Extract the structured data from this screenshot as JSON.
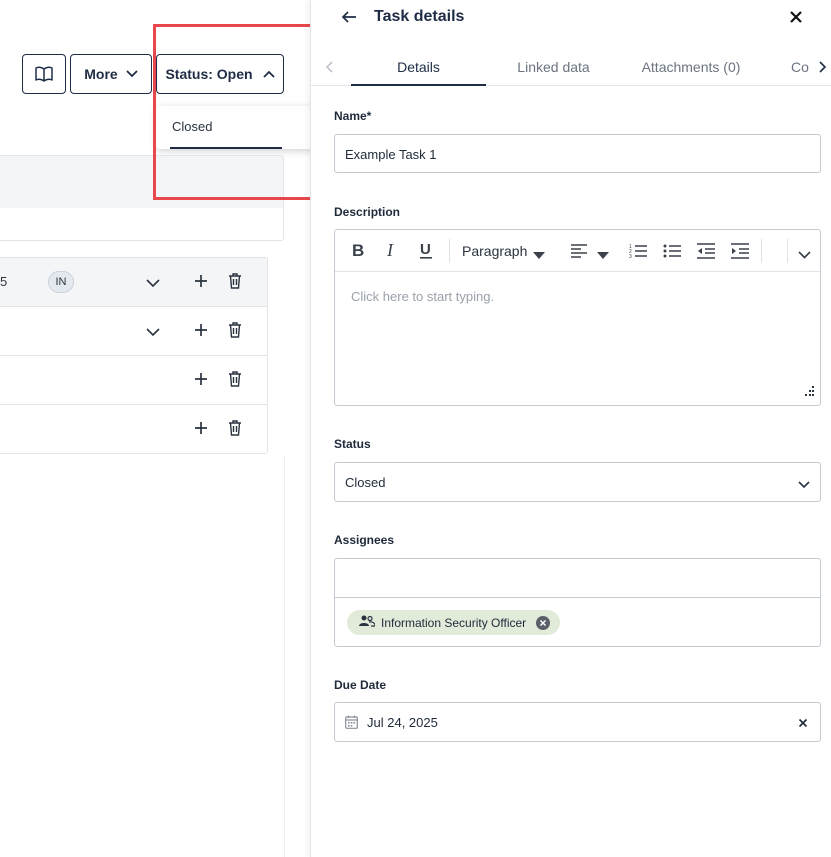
{
  "toolbar": {
    "more_label": "More",
    "status_label": "Status: Open"
  },
  "status_menu": {
    "items": [
      "Closed"
    ]
  },
  "table": {
    "rows": [
      {
        "num": "5",
        "avatar": "IN"
      },
      {
        "num": "",
        "avatar": ""
      },
      {
        "num": "",
        "avatar": ""
      },
      {
        "num": "",
        "avatar": ""
      }
    ]
  },
  "drawer": {
    "title": "Task details",
    "tabs": [
      {
        "label": "Details",
        "active": true
      },
      {
        "label": "Linked data",
        "active": false
      },
      {
        "label": "Attachments (0)",
        "active": false
      },
      {
        "label": "Co",
        "active": false
      }
    ],
    "name_label": "Name*",
    "name_value": "Example Task 1",
    "description_label": "Description",
    "editor": {
      "paragraph_style": "Paragraph",
      "placeholder": "Click here to start typing."
    },
    "status_label": "Status",
    "status_value": "Closed",
    "assignees_label": "Assignees",
    "assignees": [
      "Information Security Officer"
    ],
    "due_date_label": "Due Date",
    "due_date_value": "Jul 24, 2025"
  },
  "colors": {
    "brand": "#1e2d45",
    "highlight": "#e8474b",
    "chip": "#e2ead9"
  },
  "icons": [
    "book-icon",
    "chevron-down-icon",
    "chevron-up-icon",
    "plus-icon",
    "trash-icon",
    "arrow-left-icon",
    "close-icon",
    "chevron-left-icon",
    "chevron-right-icon",
    "bold-icon",
    "italic-icon",
    "underline-icon",
    "align-left-icon",
    "ordered-list-icon",
    "bullet-list-icon",
    "outdent-icon",
    "indent-icon",
    "resize-handle-icon",
    "group-icon",
    "remove-chip-icon",
    "calendar-icon"
  ]
}
